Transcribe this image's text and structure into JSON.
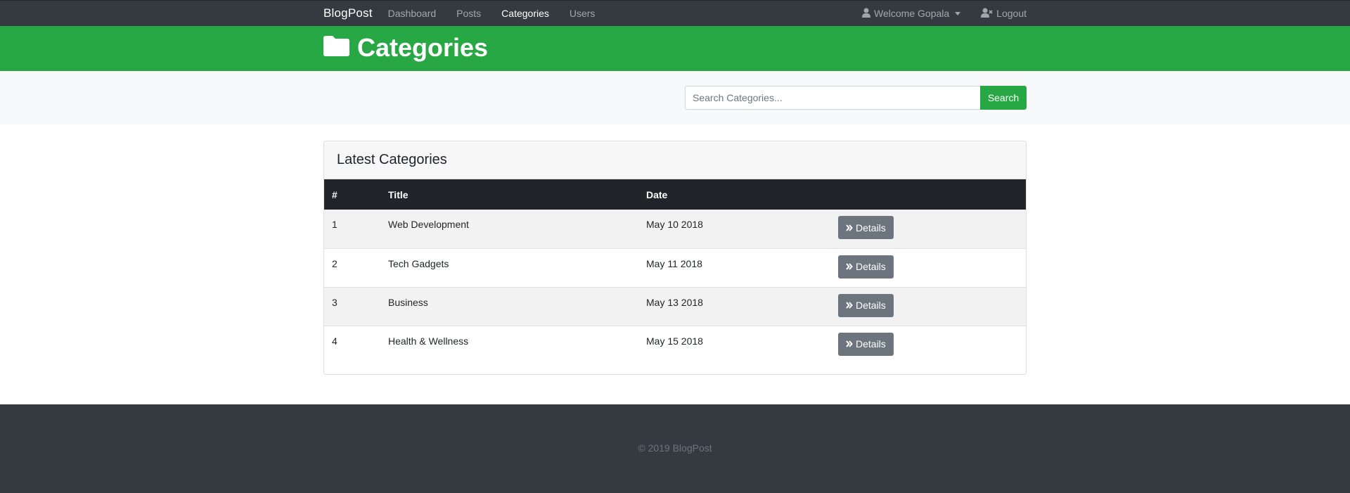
{
  "navbar": {
    "brand": "BlogPost",
    "links": [
      {
        "label": "Dashboard",
        "active": false
      },
      {
        "label": "Posts",
        "active": false
      },
      {
        "label": "Categories",
        "active": true
      },
      {
        "label": "Users",
        "active": false
      }
    ],
    "welcome": "Welcome Gopala",
    "logout": "Logout"
  },
  "header": {
    "title": "Categories",
    "icon": "folder-icon"
  },
  "search": {
    "placeholder": "Search Categories...",
    "button": "Search"
  },
  "card": {
    "title": "Latest Categories",
    "columns": [
      "#",
      "Title",
      "Date",
      ""
    ],
    "rows": [
      {
        "num": "1",
        "title": "Web Development",
        "date": "May 10 2018",
        "action": "Details"
      },
      {
        "num": "2",
        "title": "Tech Gadgets",
        "date": "May 11 2018",
        "action": "Details"
      },
      {
        "num": "3",
        "title": "Business",
        "date": "May 13 2018",
        "action": "Details"
      },
      {
        "num": "4",
        "title": "Health & Wellness",
        "date": "May 15 2018",
        "action": "Details"
      }
    ]
  },
  "footer": {
    "text": "© 2019 BlogPost"
  },
  "colors": {
    "navbar": "#343a40",
    "header": "#28a745",
    "search_button": "#28a745",
    "details_button": "#6c757d",
    "table_head": "#212529"
  }
}
